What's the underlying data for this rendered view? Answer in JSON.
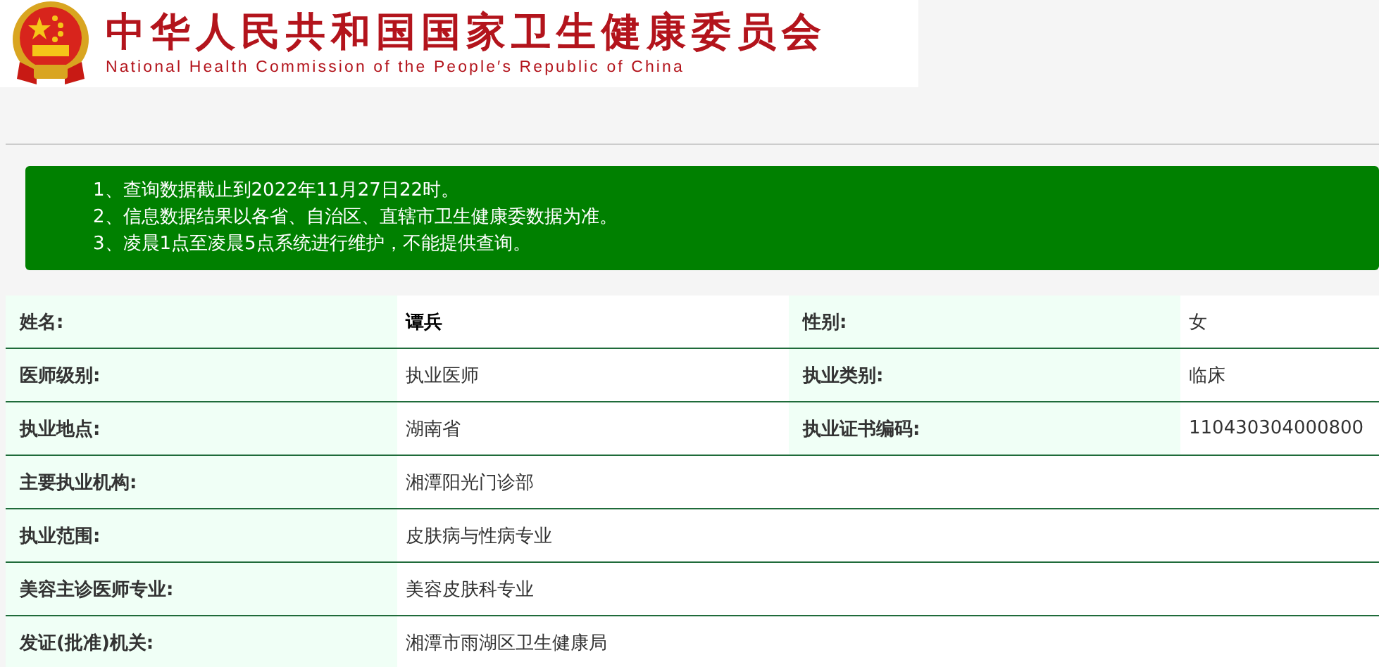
{
  "header": {
    "title": "中华人民共和国国家卫生健康委员会",
    "subtitle": "National Health Commission of the People′s Republic of China"
  },
  "notice": [
    "1、查询数据截止到2022年11月27日22时。",
    "2、信息数据结果以各省、自治区、直辖市卫生健康委数据为准。",
    "3、凌晨1点至凌晨5点系统进行维护，不能提供查询。"
  ],
  "rows": [
    {
      "fields": [
        {
          "label": "姓名:",
          "value": "谭兵",
          "bold": true
        },
        {
          "label": "性别:",
          "value": "女",
          "bold": false
        }
      ]
    },
    {
      "fields": [
        {
          "label": "医师级别:",
          "value": "执业医师",
          "bold": false
        },
        {
          "label": "执业类别:",
          "value": "临床",
          "bold": false
        }
      ]
    },
    {
      "fields": [
        {
          "label": "执业地点:",
          "value": "湖南省",
          "bold": false
        },
        {
          "label": "执业证书编码:",
          "value": "110430304000800",
          "bold": false
        }
      ]
    },
    {
      "fields": [
        {
          "label": "主要执业机构:",
          "value": "湘潭阳光门诊部",
          "bold": false
        }
      ]
    },
    {
      "fields": [
        {
          "label": "执业范围:",
          "value": "皮肤病与性病专业",
          "bold": false
        }
      ]
    },
    {
      "fields": [
        {
          "label": "美容主诊医师专业:",
          "value": "美容皮肤科专业",
          "bold": false
        }
      ]
    },
    {
      "fields": [
        {
          "label": "发证(批准)机关:",
          "value": "湘潭市雨湖区卫生健康局",
          "bold": false
        }
      ]
    }
  ]
}
